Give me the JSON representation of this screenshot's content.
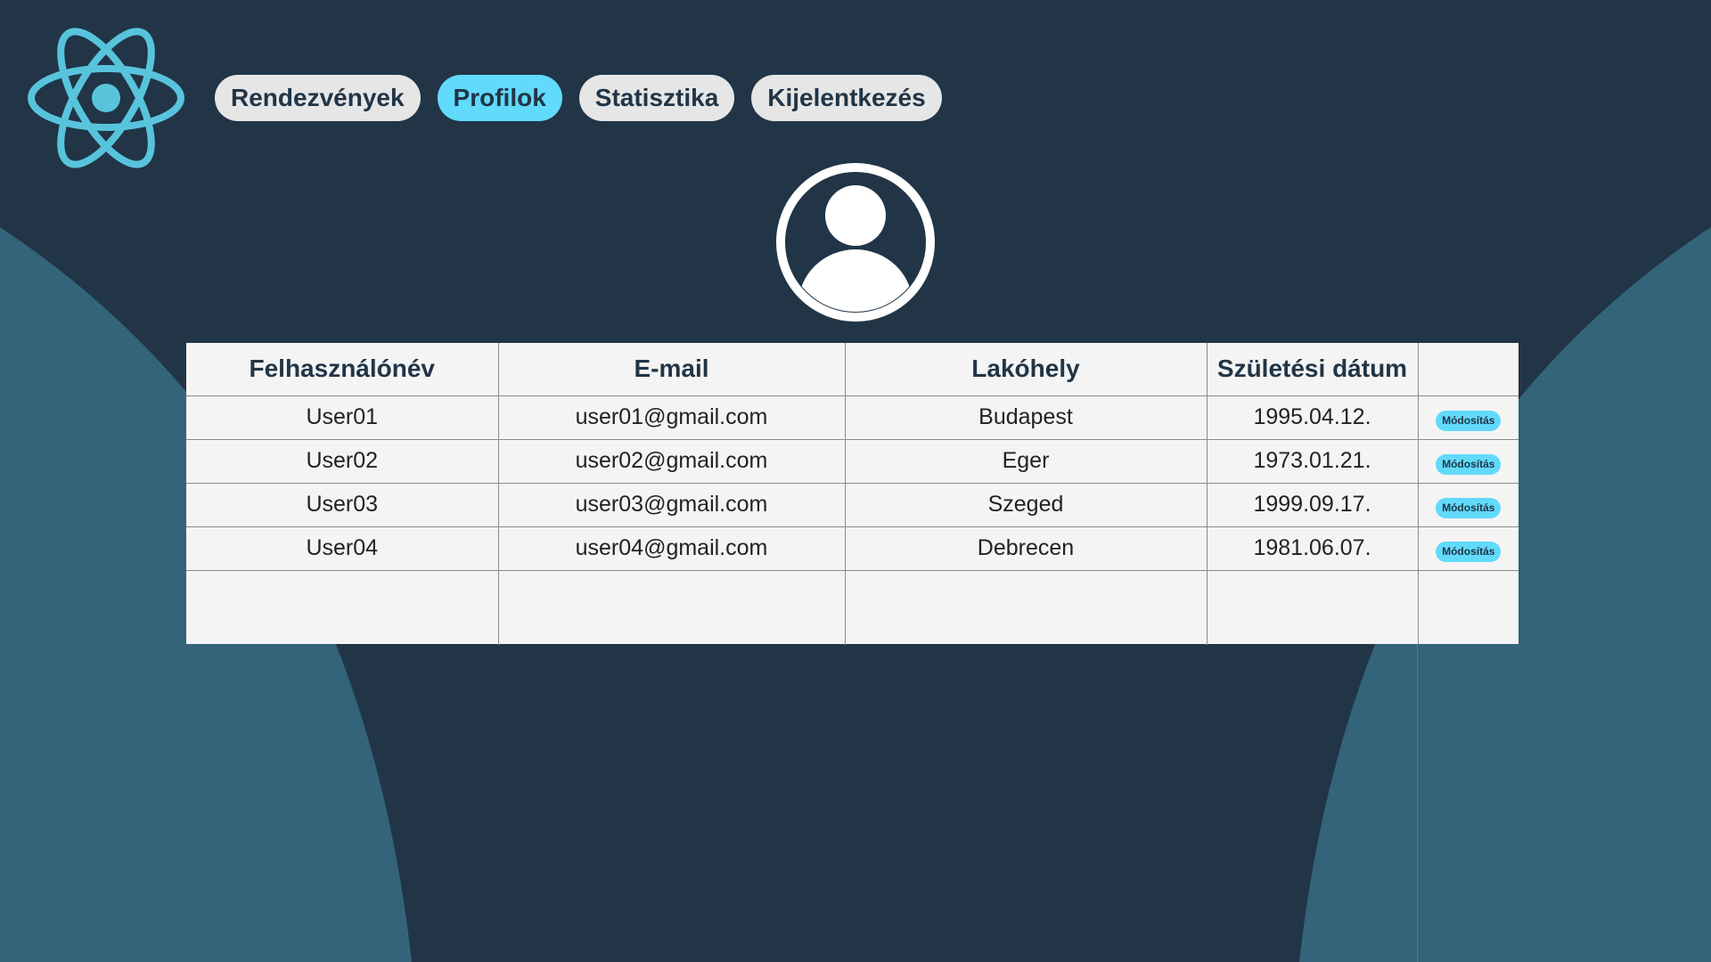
{
  "app": {
    "colors": {
      "background": "#213547",
      "accent": "#61dafb",
      "shape": "#33647a"
    },
    "logo_icon": "react-logo-icon"
  },
  "nav": {
    "items": [
      {
        "label": "Rendezvények",
        "active": false
      },
      {
        "label": "Profilok",
        "active": true
      },
      {
        "label": "Statisztika",
        "active": false
      },
      {
        "label": "Kijelentkezés",
        "active": false
      }
    ]
  },
  "profile": {
    "icon": "user-avatar-icon"
  },
  "table": {
    "headers": [
      "Felhasználónév",
      "E-mail",
      "Lakóhely",
      "Születési dátum",
      ""
    ],
    "rows": [
      {
        "username": "User01",
        "email": "user01@gmail.com",
        "city": "Budapest",
        "birth_date": "1995.04.12.",
        "action": "Módosítás"
      },
      {
        "username": "User02",
        "email": "user02@gmail.com",
        "city": "Eger",
        "birth_date": "1973.01.21.",
        "action": "Módosítás"
      },
      {
        "username": "User03",
        "email": "user03@gmail.com",
        "city": "Szeged",
        "birth_date": "1999.09.17.",
        "action": "Módosítás"
      },
      {
        "username": "User04",
        "email": "user04@gmail.com",
        "city": "Debrecen",
        "birth_date": "1981.06.07.",
        "action": "Módosítás"
      }
    ]
  }
}
